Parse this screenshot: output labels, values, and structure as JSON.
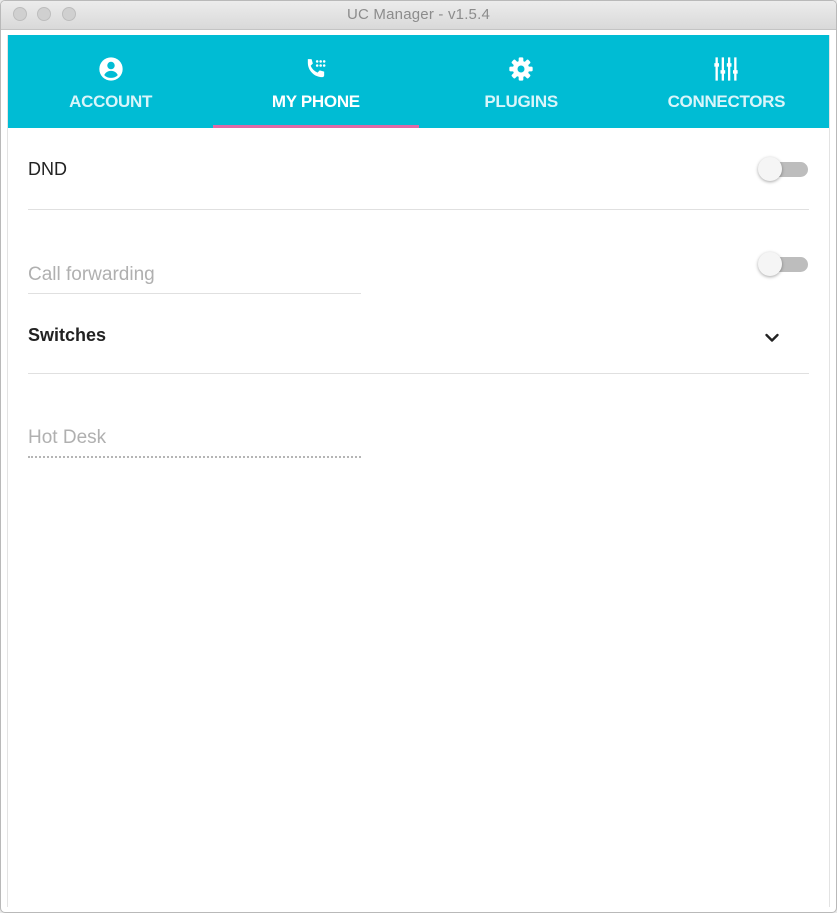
{
  "window": {
    "title": "UC Manager - v1.5.4"
  },
  "tabs": [
    {
      "label": "ACCOUNT",
      "icon": "account-circle-icon",
      "active": false
    },
    {
      "label": "MY PHONE",
      "icon": "phone-dialpad-icon",
      "active": true
    },
    {
      "label": "PLUGINS",
      "icon": "gear-icon",
      "active": false
    },
    {
      "label": "CONNECTORS",
      "icon": "sliders-icon",
      "active": false
    }
  ],
  "dnd": {
    "label": "DND",
    "enabled": false
  },
  "call_forwarding": {
    "placeholder": "Call forwarding",
    "value": "",
    "enabled": false
  },
  "switches": {
    "label": "Switches",
    "icon": "chevron-down-icon"
  },
  "hot_desk": {
    "placeholder": "Hot Desk",
    "value": ""
  },
  "colors": {
    "accent": "#00bcd4",
    "tab_ink": "#e06aa6",
    "toggle_off_track": "#bdbdbd"
  }
}
